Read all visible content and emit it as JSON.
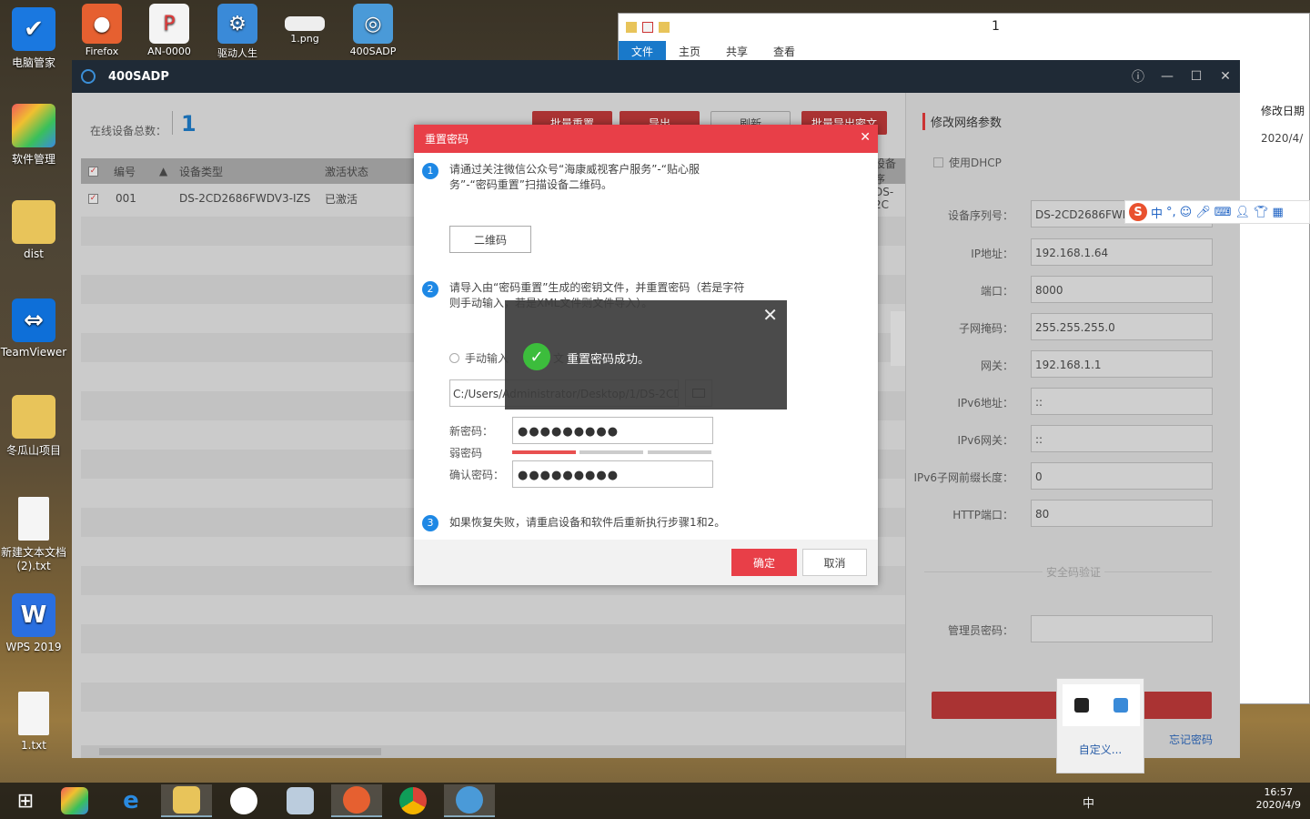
{
  "desktop_icons": [
    {
      "label": "电脑管家",
      "color": "#1a78e0",
      "glyph": "shield-icon"
    },
    {
      "label": "软件管理",
      "color": "#f0a030",
      "glyph": "clover-icon"
    },
    {
      "label": "dist",
      "color": "#e8c45a",
      "glyph": "folder-icon"
    },
    {
      "label": "TeamViewer",
      "color": "#0e6fd8",
      "glyph": "teamviewer-icon"
    },
    {
      "label": "冬瓜山项目",
      "color": "#e8c45a",
      "glyph": "folder-icon"
    },
    {
      "label": "新建文本文档 (2).txt",
      "color": "#f5f5f5",
      "glyph": "text-file-icon"
    },
    {
      "label": "WPS 2019",
      "color": "#2a6fe0",
      "glyph": "wps-icon"
    },
    {
      "label": "1.txt",
      "color": "#f5f5f5",
      "glyph": "text-file-icon"
    }
  ],
  "top_icons": [
    {
      "label": "Firefox",
      "color": "#e66030"
    },
    {
      "label": "AN-0000",
      "color": "#e03a3a"
    },
    {
      "label": "驱动人生",
      "color": "#3a8ad8"
    },
    {
      "label": "1.png",
      "color": "#dddddd"
    },
    {
      "label": "400SADP",
      "color": "#4a9ad8"
    }
  ],
  "explorer": {
    "title": "1",
    "ribbon": [
      "文件",
      "主页",
      "共享",
      "查看"
    ],
    "col_header": "修改日期",
    "col_value": "2020/4/"
  },
  "app": {
    "title": "400SADP",
    "online_label": "在线设备总数：",
    "online_count": "1",
    "top_buttons": [
      "批量重置",
      "导出",
      "刷新",
      "批量导出密文"
    ],
    "columns": [
      "编号",
      "设备类型",
      "激活状态",
      "设备序"
    ],
    "rows": [
      {
        "id": "001",
        "type": "DS-2CD2686FWDV3-IZS",
        "status": "已激活",
        "serial": "DS-2C"
      }
    ]
  },
  "panel": {
    "title": "修改网络参数",
    "dhcp": "使用DHCP",
    "fields": [
      {
        "label": "设备序列号：",
        "value": "DS-2CD2686FWD"
      },
      {
        "label": "IP地址：",
        "value": "192.168.1.64"
      },
      {
        "label": "端口：",
        "value": "8000"
      },
      {
        "label": "子网掩码：",
        "value": "255.255.255.0"
      },
      {
        "label": "网关：",
        "value": "192.168.1.1"
      },
      {
        "label": "IPv6地址：",
        "value": "::"
      },
      {
        "label": "IPv6网关：",
        "value": "::"
      },
      {
        "label": "IPv6子网前缀长度：",
        "value": "0"
      },
      {
        "label": "HTTP端口：",
        "value": "80"
      }
    ],
    "security": "安全码验证",
    "admin_pwd": "管理员密码：",
    "forgot": "忘记密码"
  },
  "dialog": {
    "title": "重置密码",
    "step1": "请通过关注微信公众号“海康威视客户服务”-“贴心服务”-“密码重置”扫描设备二维码。",
    "qr_button": "二维码",
    "step2": "请导入由“密码重置”生成的密钥文件，并重置密码（若是字符则手动输入，若是XML文件则文件导入）。",
    "manual": "手动输入",
    "file_label": "文",
    "path": "C:/Users/Administrator/Desktop/1/DS-2CD",
    "new_pwd": "新密码：",
    "new_pwd_val": "●●●●●●●●●",
    "strength": "弱密码",
    "confirm_pwd": "确认密码：",
    "confirm_val": "●●●●●●●●●",
    "step3": "如果恢复失败，请重启设备和软件后重新执行步骤1和2。",
    "ok": "确定",
    "cancel": "取消"
  },
  "toast": {
    "message": "重置密码成功。"
  },
  "ime": {
    "lang": "中"
  },
  "tray_popup": {
    "custom": "自定义..."
  },
  "clock": {
    "time": "16:57",
    "date": "2020/4/9"
  },
  "tray_text": "中"
}
